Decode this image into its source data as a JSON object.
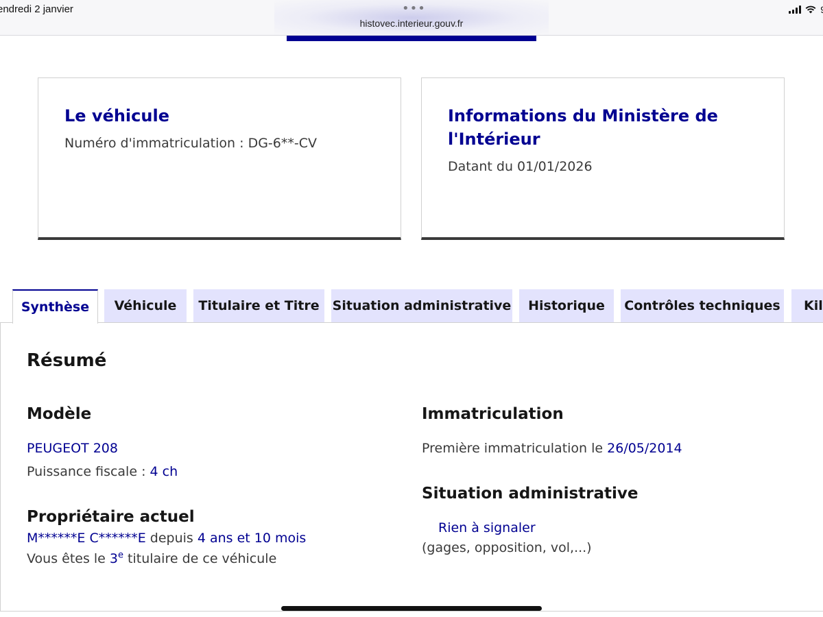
{
  "statusbar": {
    "date": "endredi 2 janvier",
    "url_dots": "•••",
    "url": "histovec.interieur.gouv.fr",
    "battery": "9",
    "signal_icon": "cellular-signal-icon",
    "wifi_icon": "wifi-icon"
  },
  "cards": {
    "vehicle": {
      "title": "Le véhicule",
      "plate_label": "Numéro d'immatriculation : ",
      "plate_value": "DG-6**-CV"
    },
    "ministry": {
      "title": "Informations du Ministère de l'Intérieur",
      "date_label": "Datant du ",
      "date_value": "01/01/2026"
    }
  },
  "tabs": [
    {
      "label": "Synthèse",
      "active": true
    },
    {
      "label": "Véhicule"
    },
    {
      "label": "Titulaire et Titre"
    },
    {
      "label": "Situation administrative"
    },
    {
      "label": "Historique"
    },
    {
      "label": "Contrôles techniques"
    },
    {
      "label": "Kil"
    }
  ],
  "summary": {
    "title": "Résumé",
    "model": {
      "heading": "Modèle",
      "name": "PEUGEOT 208",
      "power_label": "Puissance fiscale : ",
      "power_value": "4 ch"
    },
    "owner": {
      "heading": "Propriétaire actuel",
      "name": "M******E C******E",
      "since_label": " depuis ",
      "since_value": "4 ans et 10 mois",
      "rank_prefix": "Vous êtes le ",
      "rank_value": "3",
      "rank_sup": "e",
      "rank_suffix": " titulaire de ce véhicule"
    },
    "registration": {
      "heading": "Immatriculation",
      "first_label": "Première immatriculation le ",
      "first_value": "26/05/2014"
    },
    "admin": {
      "heading": "Situation administrative",
      "status": "Rien à signaler",
      "note": "(gages, opposition, vol,...)"
    }
  }
}
